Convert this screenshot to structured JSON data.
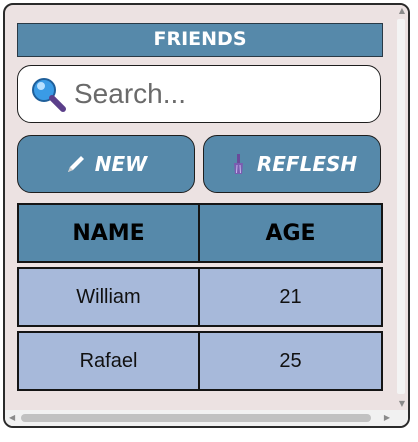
{
  "header": {
    "title": "FRIENDS"
  },
  "search": {
    "placeholder": "Search...",
    "value": ""
  },
  "toolbar": {
    "new_label": "NEW",
    "refresh_label": "REFLESH",
    "new_icon": "pencil-icon",
    "refresh_icon": "broom-icon"
  },
  "table": {
    "headers": [
      "NAME",
      "AGE"
    ],
    "rows": [
      {
        "name": "William",
        "age": "21"
      },
      {
        "name": "Rafael",
        "age": "25"
      }
    ]
  },
  "colors": {
    "accent": "#5689aa",
    "row_bg": "#a7b9da",
    "panel_bg": "#ece2e2"
  }
}
